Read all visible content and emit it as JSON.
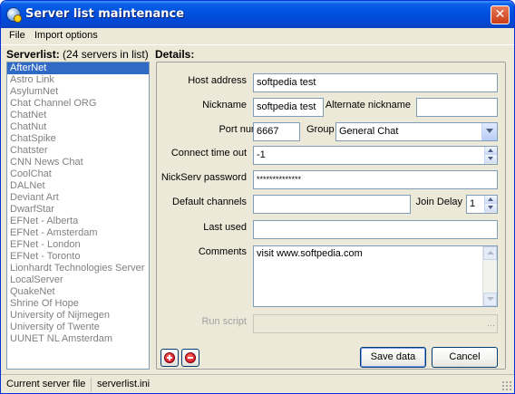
{
  "window": {
    "title": "Server list maintenance"
  },
  "menu": {
    "file": "File",
    "import_options": "Import options"
  },
  "serverlist": {
    "label": "Serverlist:",
    "count_text": "(24 servers in list)",
    "items": [
      "AfterNet",
      "Astro Link",
      "AsylumNet",
      "Chat Channel ORG",
      "ChatNet",
      "ChatNut",
      "ChatSpike",
      "Chatster",
      "CNN News Chat",
      "CoolChat",
      "DALNet",
      "Deviant Art",
      "DwarfStar",
      "EFNet - Alberta",
      "EFNet - Amsterdam",
      "EFNet - London",
      "EFNet - Toronto",
      "Lionhardt Technologies Server",
      "LocalServer",
      "QuakeNet",
      "Shrine Of Hope",
      "University of Nijmegen",
      "University of Twente",
      "UUNET NL Amsterdam"
    ],
    "selected_index": 0
  },
  "details": {
    "label": "Details:",
    "host_address": {
      "label": "Host address",
      "value": "softpedia test"
    },
    "nickname": {
      "label": "Nickname",
      "value": "softpedia test"
    },
    "alternate_nickname": {
      "label": "Alternate nickname",
      "value": ""
    },
    "port_number": {
      "label": "Port number",
      "value": "6667"
    },
    "group": {
      "label": "Group",
      "value": "General Chat"
    },
    "connect_timeout": {
      "label": "Connect time out",
      "value": "-1"
    },
    "nickserv_password": {
      "label": "NickServ password",
      "value": "**************"
    },
    "default_channels": {
      "label": "Default channels",
      "value": ""
    },
    "join_delay": {
      "label": "Join Delay",
      "value": "1"
    },
    "last_used": {
      "label": "Last used",
      "value": ""
    },
    "comments": {
      "label": "Comments",
      "value": "visit www.softpedia.com"
    },
    "run_script": {
      "label": "Run script",
      "value": "",
      "browse": "..."
    }
  },
  "buttons": {
    "save": "Save data",
    "cancel": "Cancel"
  },
  "statusbar": {
    "label": "Current server file",
    "value": "serverlist.ini"
  },
  "colors": {
    "title_bar": "#0052e0",
    "selection": "#316ac5",
    "disabled_text": "#a0a0a0"
  }
}
